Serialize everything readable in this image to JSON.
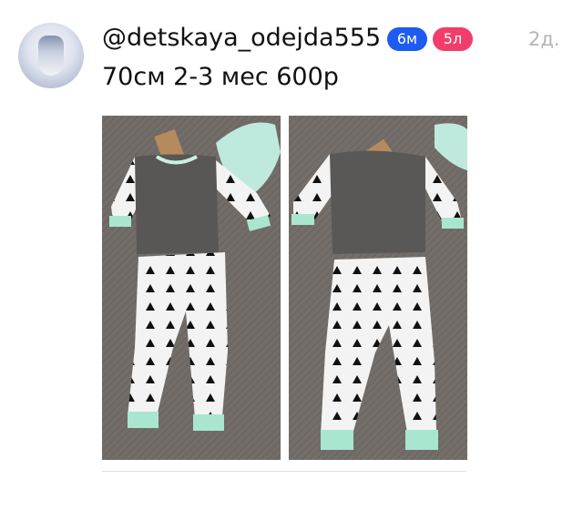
{
  "post": {
    "username": "@detskaya_odejda555",
    "badges": {
      "months": {
        "label": "6м",
        "color": "#1e5bf2"
      },
      "likes": {
        "label": "5л",
        "color": "#f23d6a"
      }
    },
    "timestamp": "2д.",
    "caption": "70см 2-3 мес 600р",
    "photos": [
      {
        "subject": "baby-outfit-front"
      },
      {
        "subject": "baby-outfit-back"
      }
    ]
  }
}
